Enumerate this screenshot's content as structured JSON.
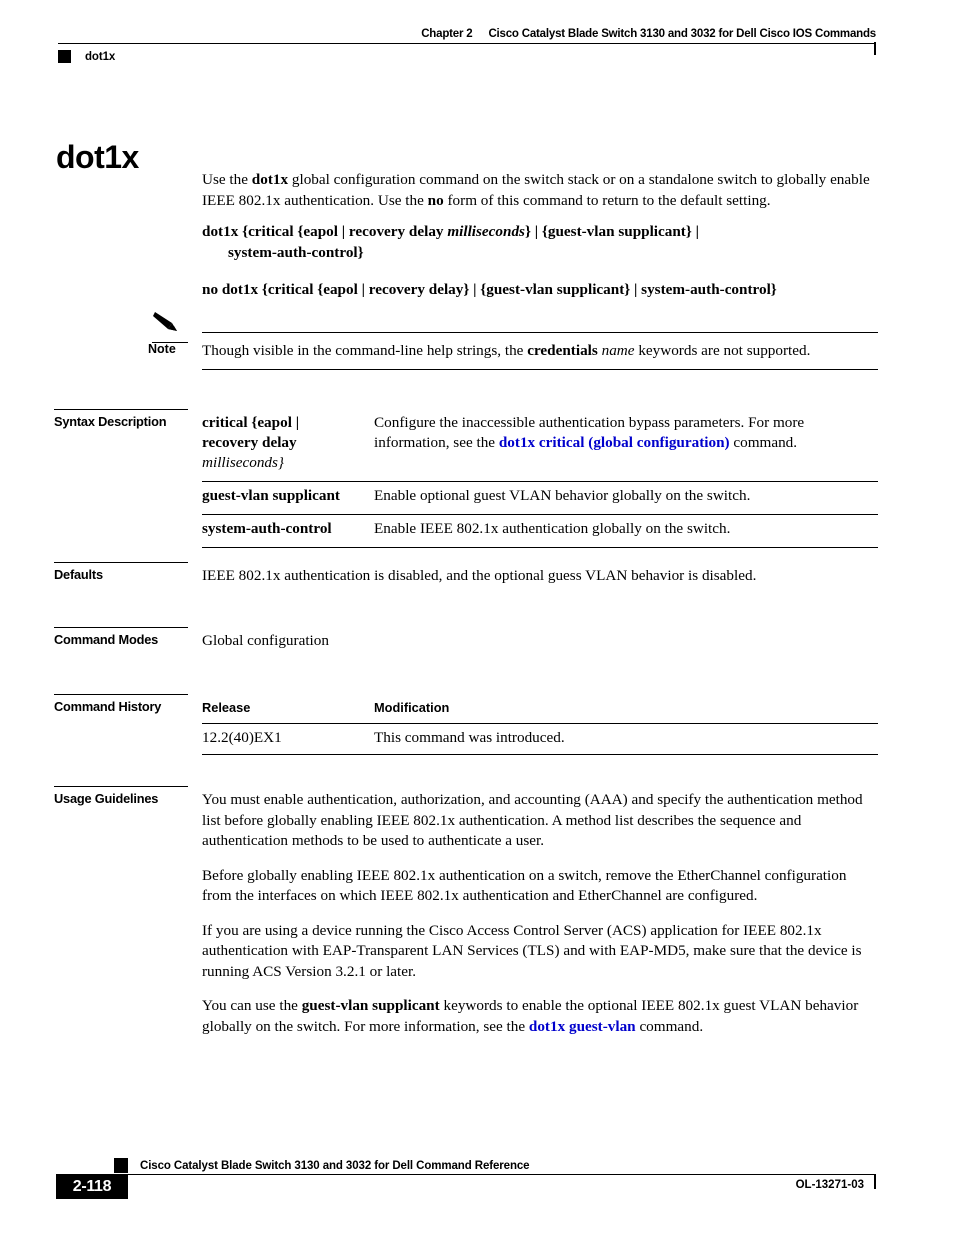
{
  "header": {
    "chapter": "Chapter 2",
    "chapter_title": "Cisco Catalyst Blade Switch 3130 and 3032 for Dell Cisco IOS Commands",
    "running_command": "dot1x"
  },
  "title": "dot1x",
  "intro": {
    "text_1": "Use the ",
    "bold_1": "dot1x",
    "text_2": " global configuration command on the switch stack or on a standalone switch to globally enable IEEE 802.1x authentication. Use the ",
    "bold_2": "no",
    "text_3": " form of this command to return to the default setting."
  },
  "syntax": {
    "line1_a": "dot1x {critical {eapol | recovery delay ",
    "line1_italic": "milliseconds",
    "line1_b": "} | {guest-vlan supplicant} |",
    "line2": "system-auth-control}",
    "line3": "no dot1x {critical {eapol | recovery delay} | {guest-vlan supplicant} | system-auth-control}"
  },
  "note": {
    "label": "Note",
    "icon": "pencil-icon",
    "text_1": "Though visible in the command-line help strings, the ",
    "bold_1": "credentials",
    "italic_1": "name",
    "text_2": " keywords are not supported."
  },
  "syntax_description": {
    "label": "Syntax Description",
    "rows": [
      {
        "term_line1": "critical {eapol |",
        "term_line2": "recovery delay",
        "term_italic": "milliseconds}",
        "desc_1": "Configure the inaccessible authentication bypass parameters. For more information, see the ",
        "desc_link": "dot1x critical (global configuration)",
        "desc_2": " command."
      },
      {
        "term": "guest-vlan supplicant",
        "desc": "Enable optional guest VLAN behavior globally on the switch."
      },
      {
        "term": "system-auth-control",
        "desc": "Enable IEEE 802.1x authentication globally on the switch."
      }
    ]
  },
  "defaults": {
    "label": "Defaults",
    "text": "IEEE 802.1x authentication is disabled, and the optional guess VLAN behavior is disabled."
  },
  "command_modes": {
    "label": "Command Modes",
    "text": "Global configuration"
  },
  "command_history": {
    "label": "Command History",
    "columns": [
      "Release",
      "Modification"
    ],
    "rows": [
      {
        "release": "12.2(40)EX1",
        "modification": "This command was introduced."
      }
    ]
  },
  "usage_guidelines": {
    "label": "Usage Guidelines",
    "paragraphs": [
      "You must enable authentication, authorization, and accounting (AAA) and specify the authentication method list before globally enabling IEEE 802.1x authentication. A method list describes the sequence and authentication methods to be used to authenticate a user.",
      "Before globally enabling IEEE 802.1x authentication on a switch, remove the EtherChannel configuration from the interfaces on which IEEE 802.1x authentication and EtherChannel are configured.",
      "If you are using a device running the Cisco Access Control Server (ACS) application for IEEE 802.1x authentication with EAP-Transparent LAN Services (TLS) and with EAP-MD5, make sure that the device is running ACS Version 3.2.1 or later."
    ],
    "last_para": {
      "text_1": "You can use the ",
      "bold_1": "guest-vlan supplicant",
      "text_2": " keywords to enable the optional IEEE 802.1x guest VLAN behavior globally on the switch. For more information, see the ",
      "link_1": "dot1x guest-vlan",
      "text_3": " command."
    }
  },
  "footer": {
    "doc_title": "Cisco Catalyst Blade Switch 3130 and 3032 for Dell Command Reference",
    "page_number": "2-118",
    "doc_id": "OL-13271-03"
  },
  "colors": {
    "link": "#0000cc",
    "text": "#000000",
    "background": "#ffffff"
  }
}
